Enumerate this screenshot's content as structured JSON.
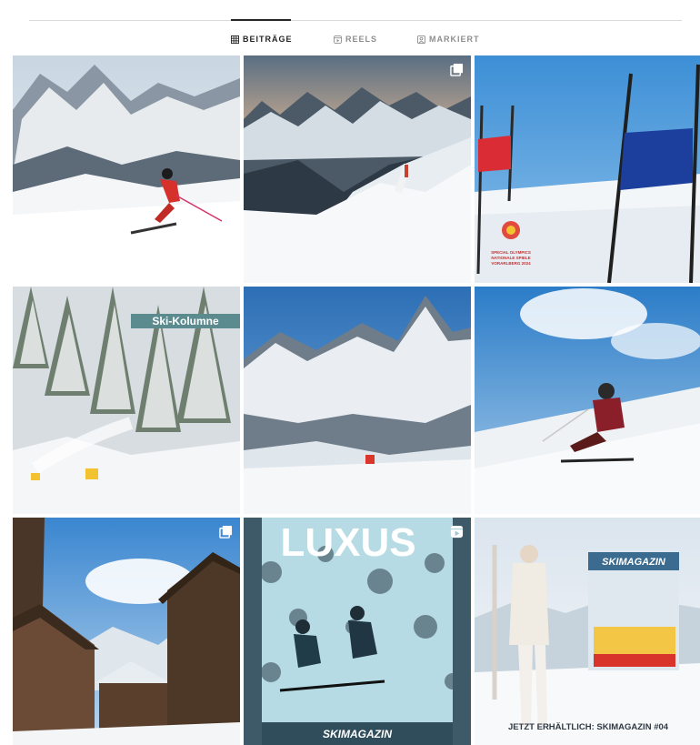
{
  "tabs": [
    {
      "label": "BEITRÄGE",
      "icon": "grid-icon",
      "active": true
    },
    {
      "label": "REELS",
      "icon": "reels-icon",
      "active": false
    },
    {
      "label": "MARKIERT",
      "icon": "tagged-icon",
      "active": false
    }
  ],
  "posts": [
    {
      "name": "post-skier-red-jacket",
      "icon": null
    },
    {
      "name": "post-mountain-ridge",
      "icon": "multi-image-icon"
    },
    {
      "name": "post-race-gates",
      "icon": null,
      "logo_text": "SPECIAL OLYMPICS NATIONALE SPIELE VORARLBERG 2024"
    },
    {
      "name": "post-ski-kolumne",
      "icon": null,
      "label": "Ski-Kolumne"
    },
    {
      "name": "post-alpine-peak",
      "icon": null
    },
    {
      "name": "post-carving-skier",
      "icon": null
    },
    {
      "name": "post-wooden-huts",
      "icon": "multi-image-icon"
    },
    {
      "name": "post-luxus-cover",
      "icon": "reel-video-icon",
      "title": "LUXUS",
      "brand": "SKIMAGAZIN"
    },
    {
      "name": "post-skimagazin-04",
      "icon": null,
      "magazine": "SKIMAGAZIN",
      "cta": "JETZT ERHÄLTLICH: SKIMAGAZIN #04"
    }
  ]
}
